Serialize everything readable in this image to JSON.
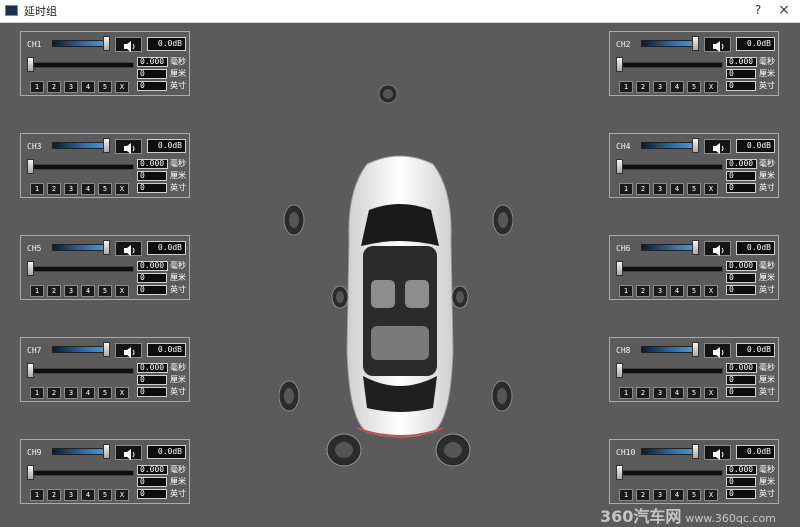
{
  "window": {
    "title": "延时组",
    "help_label": "?",
    "close_label": "×"
  },
  "channels": [
    {
      "name": "CH1",
      "db": "0.0dB",
      "ms": "0.000",
      "cm": "0",
      "inch": "0"
    },
    {
      "name": "CH2",
      "db": "0.0dB",
      "ms": "0.000",
      "cm": "0",
      "inch": "0"
    },
    {
      "name": "CH3",
      "db": "0.0dB",
      "ms": "0.000",
      "cm": "0",
      "inch": "0"
    },
    {
      "name": "CH4",
      "db": "0.0dB",
      "ms": "0.000",
      "cm": "0",
      "inch": "0"
    },
    {
      "name": "CH5",
      "db": "0.0dB",
      "ms": "0.000",
      "cm": "0",
      "inch": "0"
    },
    {
      "name": "CH6",
      "db": "0.0dB",
      "ms": "0.000",
      "cm": "0",
      "inch": "0"
    },
    {
      "name": "CH7",
      "db": "0.0dB",
      "ms": "0.000",
      "cm": "0",
      "inch": "0"
    },
    {
      "name": "CH8",
      "db": "0.0dB",
      "ms": "0.000",
      "cm": "0",
      "inch": "0"
    },
    {
      "name": "CH9",
      "db": "0.0dB",
      "ms": "0.000",
      "cm": "0",
      "inch": "0"
    },
    {
      "name": "CH10",
      "db": "0.0dB",
      "ms": "0.000",
      "cm": "0",
      "inch": "0"
    }
  ],
  "units": {
    "ms": "毫秒",
    "cm": "厘米",
    "inch": "英寸"
  },
  "presets": [
    "1",
    "2",
    "3",
    "4",
    "5",
    "X"
  ],
  "volume_level": 0.9,
  "delay_level": 0.0,
  "icons": {
    "speaker_toggle": "speaker-volume-icon",
    "car": "car-top-view-icon",
    "speaker": "loudspeaker-icon"
  },
  "watermark": {
    "brand": "360汽车网",
    "url": "www.360qc.com"
  },
  "colors": {
    "background": "#5b5b5b",
    "slider_blue": "#4aa3e6",
    "panel_border": "#aaaaaa"
  }
}
